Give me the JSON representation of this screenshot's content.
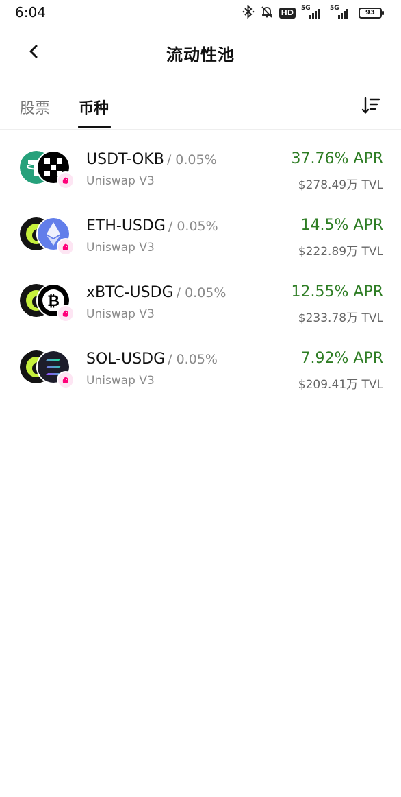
{
  "status_bar": {
    "time": "6:04",
    "hd_label": "HD",
    "network_1": "5G",
    "network_2": "5G",
    "battery": "93"
  },
  "header": {
    "title": "流动性池"
  },
  "tabs": [
    {
      "label": "股票",
      "active": false
    },
    {
      "label": "币种",
      "active": true
    }
  ],
  "pools": [
    {
      "pair": "USDT-OKB",
      "fee": "/ 0.05%",
      "protocol": "Uniswap V3",
      "apr": "37.76% APR",
      "tvl": "$278.49万 TVL"
    },
    {
      "pair": "ETH-USDG",
      "fee": "/ 0.05%",
      "protocol": "Uniswap V3",
      "apr": "14.5% APR",
      "tvl": "$222.89万 TVL"
    },
    {
      "pair": "xBTC-USDG",
      "fee": "/ 0.05%",
      "protocol": "Uniswap V3",
      "apr": "12.55% APR",
      "tvl": "$233.78万 TVL"
    },
    {
      "pair": "SOL-USDG",
      "fee": "/ 0.05%",
      "protocol": "Uniswap V3",
      "apr": "7.92% APR",
      "tvl": "$209.41万 TVL"
    }
  ],
  "colors": {
    "apr_green": "#2e7d24",
    "usdt_green": "#26a17b",
    "usdg_lime": "#c6f03c",
    "eth_blue": "#627eea",
    "uniswap_pink": "#ff007a"
  }
}
